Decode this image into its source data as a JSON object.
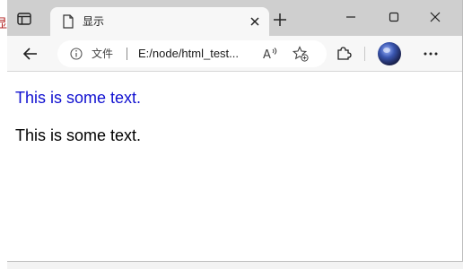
{
  "desktop": {
    "edge_fragment_1": "r",
    "edge_fragment_2": "显"
  },
  "tab": {
    "title": "显示",
    "close_icon": "close-icon",
    "favicon_icon": "document-icon"
  },
  "titlebar": {
    "tab_actions_icon": "tab-actions-icon",
    "new_tab_icon": "plus-icon",
    "minimize_icon": "minimize-icon",
    "maximize_icon": "maximize-icon",
    "close_icon": "close-icon"
  },
  "toolbar": {
    "back_icon": "arrow-left-icon",
    "site_info_label": "文件",
    "url": "E:/node/html_test...",
    "read_aloud_icon": "read-aloud-icon",
    "favorites_icon": "star-add-icon",
    "extensions_icon": "puzzle-icon",
    "profile_icon": "avatar",
    "more_icon": "ellipsis-icon"
  },
  "page": {
    "blue_paragraph": "This is some text.",
    "black_paragraph": "This is some text."
  },
  "colors": {
    "titlebar_bg": "#cfcfcf",
    "toolbar_bg": "#f7f7f7",
    "blue_text": "#1010d0",
    "black_text": "#000000"
  }
}
